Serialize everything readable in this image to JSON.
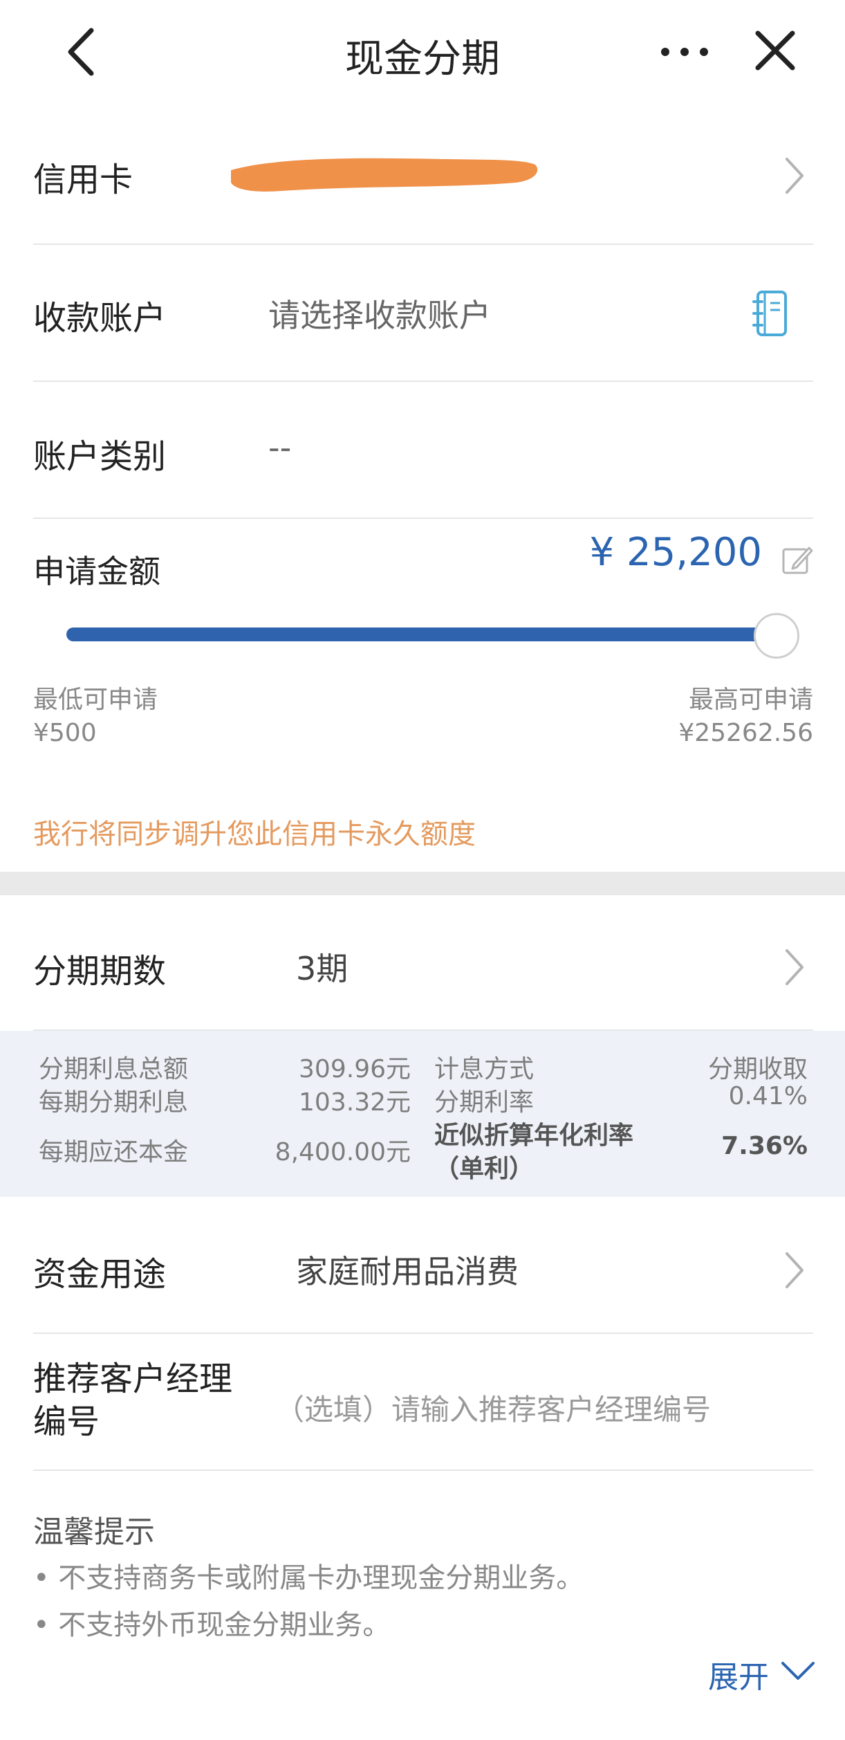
{
  "header": {
    "title": "现金分期",
    "back_icon": "chevron-left-icon",
    "more_icon": "more-dots-icon",
    "close_icon": "close-icon"
  },
  "credit_card": {
    "label": "信用卡"
  },
  "receiving_account": {
    "label": "收款账户",
    "placeholder": "请选择收款账户",
    "icon": "address-book-icon",
    "icon_color": "#4aaad8"
  },
  "account_type": {
    "label": "账户类别",
    "value": "--"
  },
  "apply_amount": {
    "label": "申请金额",
    "value": "¥ 25,200",
    "slider_fraction": 0.9975,
    "min_label": "最低可申请",
    "min_value": "¥500",
    "max_label": "最高可申请",
    "max_value": "¥25262.56",
    "notice": "我行将同步调升您此信用卡永久额度"
  },
  "installments": {
    "label": "分期期数",
    "value": "3期"
  },
  "fee_info": {
    "total_interest_label": "分期利息总额",
    "total_interest_value": "309.96元",
    "per_interest_label": "每期分期利息",
    "per_interest_value": "103.32元",
    "per_principal_label": "每期应还本金",
    "per_principal_value": "8,400.00元",
    "method_label": "计息方式",
    "method_value": "分期收取",
    "rate_label": "分期利率",
    "rate_value": "0.41%",
    "apr_label_1": "近似折算年化利率",
    "apr_label_2": "（单利）",
    "apr_value": "7.36%"
  },
  "fund_usage": {
    "label": "资金用途",
    "value": "家庭耐用品消费"
  },
  "manager": {
    "label_1": "推荐客户经理",
    "label_2": "编号",
    "placeholder": "（选填）请输入推荐客户经理编号"
  },
  "tips": {
    "title": "温馨提示",
    "items": [
      "• 不支持商务卡或附属卡办理现金分期业务。",
      "• 不支持外币现金分期业务。"
    ],
    "expand_label": "展开"
  },
  "colors": {
    "accent": "#2b64b0",
    "slider": "#2f63ad",
    "orange": "#e49a5e",
    "redaction": "#f0914a"
  }
}
